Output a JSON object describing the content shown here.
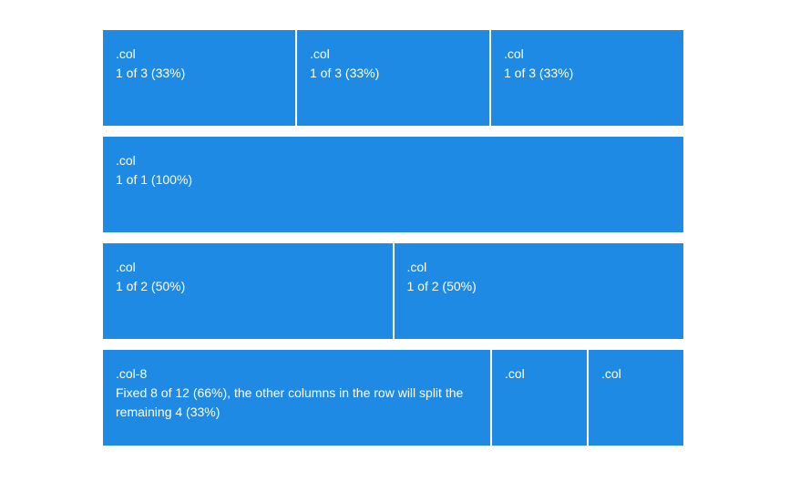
{
  "rows": [
    {
      "cols": [
        {
          "label": ".col",
          "desc": "1 of 3 (33%)"
        },
        {
          "label": ".col",
          "desc": "1 of 3 (33%)"
        },
        {
          "label": ".col",
          "desc": "1 of 3 (33%)"
        }
      ]
    },
    {
      "cols": [
        {
          "label": ".col",
          "desc": "1 of 1 (100%)"
        }
      ]
    },
    {
      "cols": [
        {
          "label": ".col",
          "desc": "1 of 2 (50%)"
        },
        {
          "label": ".col",
          "desc": "1 of 2 (50%)"
        }
      ]
    },
    {
      "cols": [
        {
          "label": ".col-8",
          "desc": "Fixed 8 of 12 (66%), the other columns in the row will split the remaining 4 (33%)"
        },
        {
          "label": ".col",
          "desc": ""
        },
        {
          "label": ".col",
          "desc": ""
        }
      ]
    }
  ],
  "colors": {
    "column_bg": "#1e8ae3",
    "text": "#ffffff",
    "page_bg": "#ffffff"
  }
}
